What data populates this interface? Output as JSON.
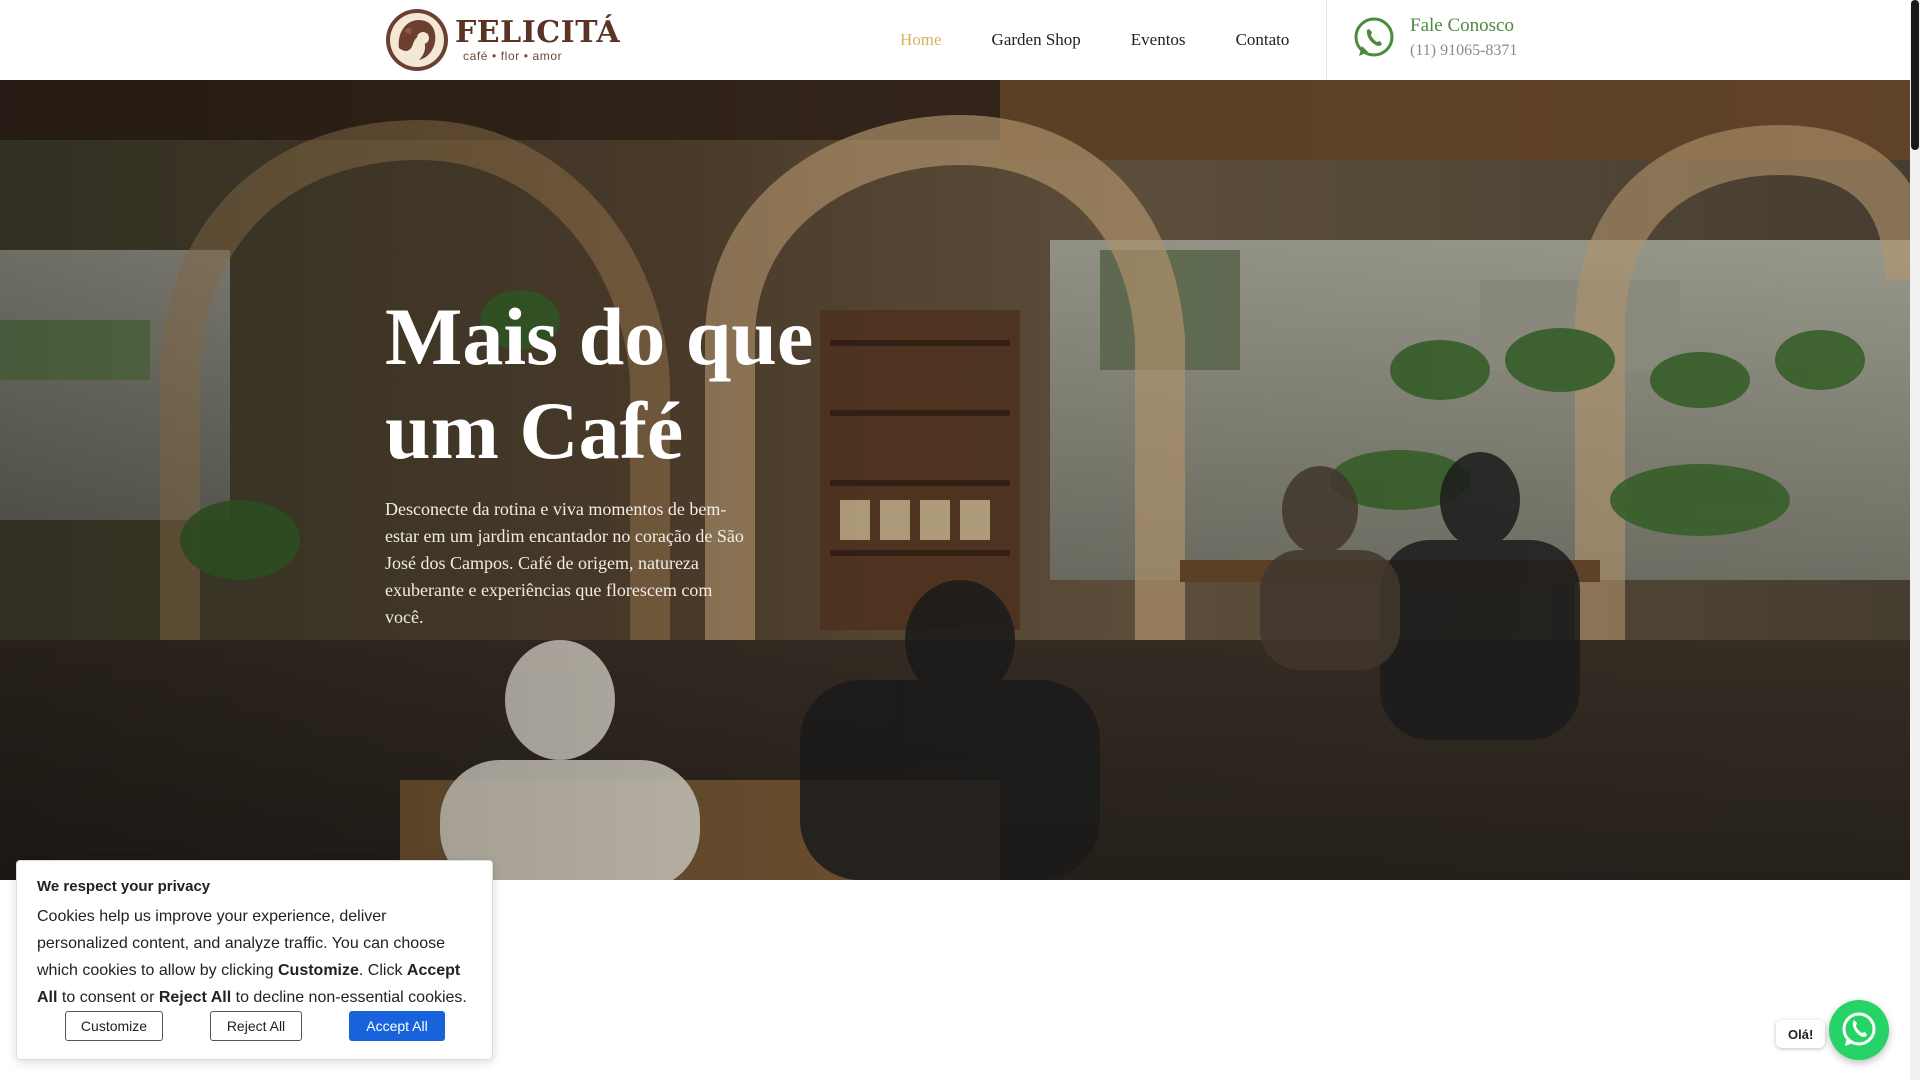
{
  "brand": {
    "name": "FELICITÁ",
    "tagline": "café • flor • amor"
  },
  "nav": {
    "items": [
      {
        "label": "Home",
        "active": true
      },
      {
        "label": "Garden Shop",
        "active": false
      },
      {
        "label": "Eventos",
        "active": false
      },
      {
        "label": "Contato",
        "active": false
      }
    ]
  },
  "contact": {
    "title": "Fale Conosco",
    "phone": "(11) 91065-8371",
    "icon": "whatsapp-icon"
  },
  "hero": {
    "title": "Mais do que\num Café",
    "subtitle": "Desconecte da rotina e viva momentos de bem-estar em um jardim encantador no coração de São José dos Campos. Café de origem, natureza exuberante e experiências que florescem com você."
  },
  "cookie": {
    "title": "We respect your privacy",
    "text_1": "Cookies help us improve your experience, deliver personalized content, and analyze traffic. You can choose which cookies to allow by clicking ",
    "bold_1": "Customize",
    "text_2": ". Click ",
    "bold_2": "Accept All",
    "text_3": " to consent or ",
    "bold_3": "Reject All",
    "text_4": " to decline non-essential cookies.",
    "buttons": {
      "customize": "Customize",
      "reject": "Reject All",
      "accept": "Accept All"
    }
  },
  "whatsapp_widget": {
    "bubble": "Olá!"
  },
  "colors": {
    "nav_active": "#d9b25c",
    "contact_green": "#4c8a3c",
    "accept_blue": "#1863dc",
    "whatsapp_green": "#25d366",
    "brand_brown": "#5a3324"
  }
}
